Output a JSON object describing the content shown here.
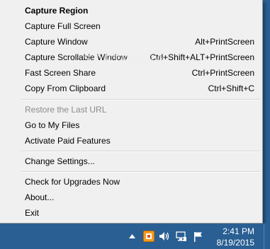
{
  "menu": {
    "items": [
      {
        "label": "Capture Region",
        "shortcut": ""
      },
      {
        "label": "Capture Full Screen",
        "shortcut": ""
      },
      {
        "label": "Capture Window",
        "shortcut": "Alt+PrintScreen"
      },
      {
        "label": "Capture Scrollable Window",
        "shortcut": "Ctrl+Shift+ALT+PrintScreen"
      },
      {
        "label": "Fast Screen Share",
        "shortcut": "Ctrl+PrintScreen"
      },
      {
        "label": "Copy From Clipboard",
        "shortcut": "Ctrl+Shift+C"
      },
      {
        "label": "Restore the Last URL",
        "shortcut": ""
      },
      {
        "label": "Go to My Files",
        "shortcut": ""
      },
      {
        "label": "Activate Paid Features",
        "shortcut": ""
      },
      {
        "label": "Change Settings...",
        "shortcut": ""
      },
      {
        "label": "Check for Upgrades Now",
        "shortcut": ""
      },
      {
        "label": "About...",
        "shortcut": ""
      },
      {
        "label": "Exit",
        "shortcut": ""
      }
    ]
  },
  "watermark": "SOFTPEDIA",
  "taskbar": {
    "time": "2:41 PM",
    "date": "8/19/2015",
    "icons": [
      "chevron-up-icon",
      "app-tray-icon",
      "speaker-icon",
      "network-icon",
      "flag-icon"
    ]
  },
  "colors": {
    "menu_bg": "#f0f0f0",
    "taskbar_bg": "#2a5f93",
    "disabled_text": "#8b8b8b"
  }
}
